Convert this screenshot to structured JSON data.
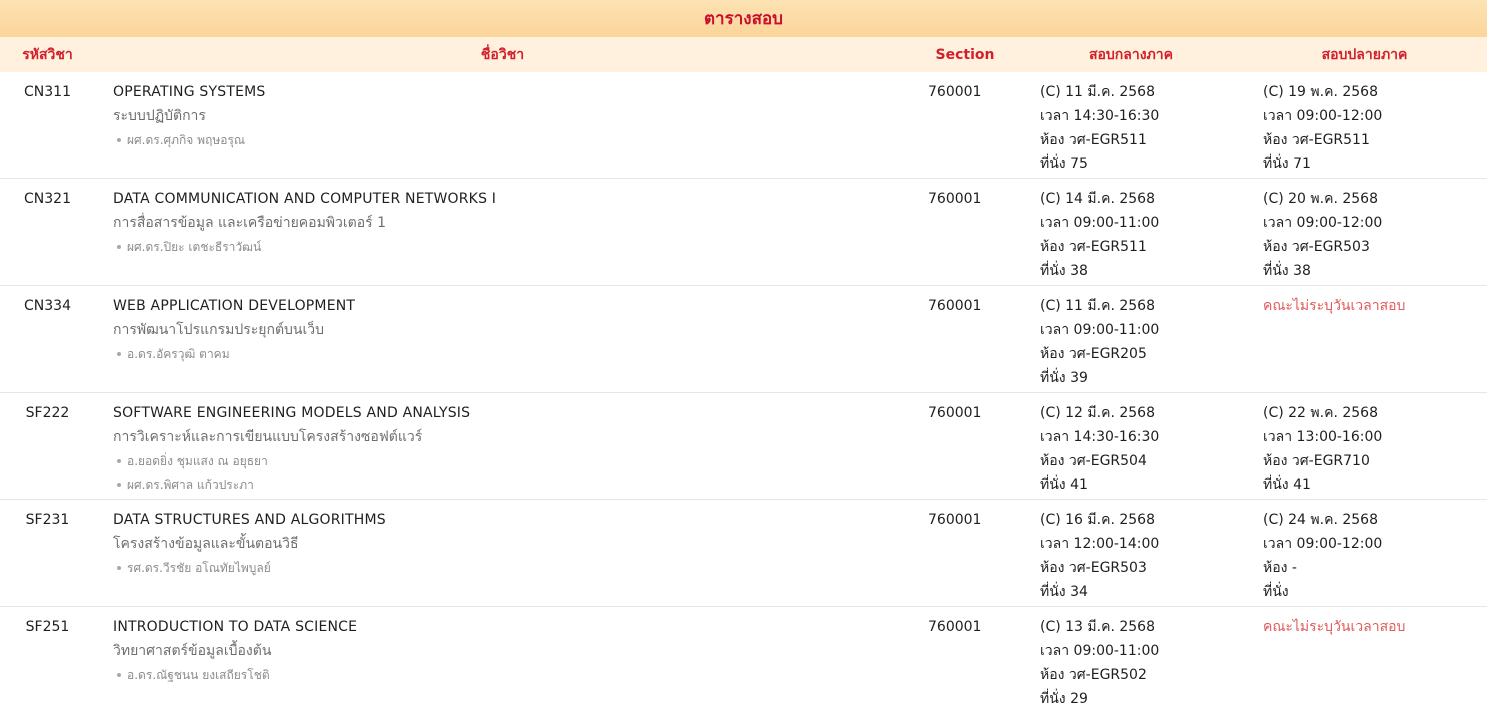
{
  "title": "ตารางสอบ",
  "headers": {
    "code": "รหัสวิชา",
    "name": "ชื่อวิชา",
    "section": "Section",
    "midterm": "สอบกลางภาค",
    "final": "สอบปลายภาค"
  },
  "colors": {
    "accent": "#c8102e",
    "header_bg": "#fff1dd",
    "title_bg": "#fbd59a",
    "no_exam": "#e05a5a"
  },
  "rows": [
    {
      "code": "CN311",
      "name_en": "OPERATING SYSTEMS",
      "name_th": "ระบบปฏิบัติการ",
      "instructors": [
        "ผศ.ดร.ศุภกิจ พฤษอรุณ"
      ],
      "section": "760001",
      "midterm": {
        "date": "(C) 11 มี.ค. 2568",
        "time": "เวลา 14:30-16:30",
        "room": "ห้อง วศ-EGR511",
        "seat": "ที่นั่ง 75"
      },
      "final": {
        "date": "(C) 19 พ.ค. 2568",
        "time": "เวลา 09:00-12:00",
        "room": "ห้อง วศ-EGR511",
        "seat": "ที่นั่ง 71"
      }
    },
    {
      "code": "CN321",
      "name_en": "DATA COMMUNICATION AND COMPUTER NETWORKS I",
      "name_th": "การสื่อสารข้อมูล และเครือข่ายคอมพิวเตอร์ 1",
      "instructors": [
        "ผศ.ดร.ปิยะ เตชะธีราวัฒน์"
      ],
      "section": "760001",
      "midterm": {
        "date": "(C) 14 มี.ค. 2568",
        "time": "เวลา 09:00-11:00",
        "room": "ห้อง วศ-EGR511",
        "seat": "ที่นั่ง 38"
      },
      "final": {
        "date": "(C) 20 พ.ค. 2568",
        "time": "เวลา 09:00-12:00",
        "room": "ห้อง วศ-EGR503",
        "seat": "ที่นั่ง 38"
      }
    },
    {
      "code": "CN334",
      "name_en": "WEB APPLICATION DEVELOPMENT",
      "name_th": "การพัฒนาโปรแกรมประยุกต์บนเว็บ",
      "instructors": [
        "อ.ดร.อัครวุฒิ ตาคม"
      ],
      "section": "760001",
      "midterm": {
        "date": "(C) 11 มี.ค. 2568",
        "time": "เวลา 09:00-11:00",
        "room": "ห้อง วศ-EGR205",
        "seat": "ที่นั่ง 39"
      },
      "final_note": "คณะไม่ระบุวันเวลาสอบ"
    },
    {
      "code": "SF222",
      "name_en": "SOFTWARE ENGINEERING MODELS AND ANALYSIS",
      "name_th": "การวิเคราะห์และการเขียนแบบโครงสร้างซอฟต์แวร์",
      "instructors": [
        "อ.ยอดยิ่ง ชุมแสง ณ อยุธยา",
        "ผศ.ดร.พิศาล แก้วประภา"
      ],
      "section": "760001",
      "midterm": {
        "date": "(C) 12 มี.ค. 2568",
        "time": "เวลา 14:30-16:30",
        "room": "ห้อง วศ-EGR504",
        "seat": "ที่นั่ง 41"
      },
      "final": {
        "date": "(C) 22 พ.ค. 2568",
        "time": "เวลา 13:00-16:00",
        "room": "ห้อง วศ-EGR710",
        "seat": "ที่นั่ง 41"
      }
    },
    {
      "code": "SF231",
      "name_en": "DATA STRUCTURES AND ALGORITHMS",
      "name_th": "โครงสร้างข้อมูลและขั้นตอนวิธี",
      "instructors": [
        "รศ.ดร.วีรชัย อโณทัยไพบูลย์"
      ],
      "section": "760001",
      "midterm": {
        "date": "(C) 16 มี.ค. 2568",
        "time": "เวลา 12:00-14:00",
        "room": "ห้อง วศ-EGR503",
        "seat": "ที่นั่ง 34"
      },
      "final": {
        "date": "(C) 24 พ.ค. 2568",
        "time": "เวลา 09:00-12:00",
        "room": "ห้อง -",
        "seat": "ที่นั่ง"
      }
    },
    {
      "code": "SF251",
      "name_en": "INTRODUCTION TO DATA SCIENCE",
      "name_th": "วิทยาศาสตร์ข้อมูลเบื้องต้น",
      "instructors": [
        "อ.ดร.ณัฐชนน ยงเสถียรโชติ"
      ],
      "section": "760001",
      "midterm": {
        "date": "(C) 13 มี.ค. 2568",
        "time": "เวลา 09:00-11:00",
        "room": "ห้อง วศ-EGR502",
        "seat": "ที่นั่ง 29"
      },
      "final_note": "คณะไม่ระบุวันเวลาสอบ"
    }
  ]
}
